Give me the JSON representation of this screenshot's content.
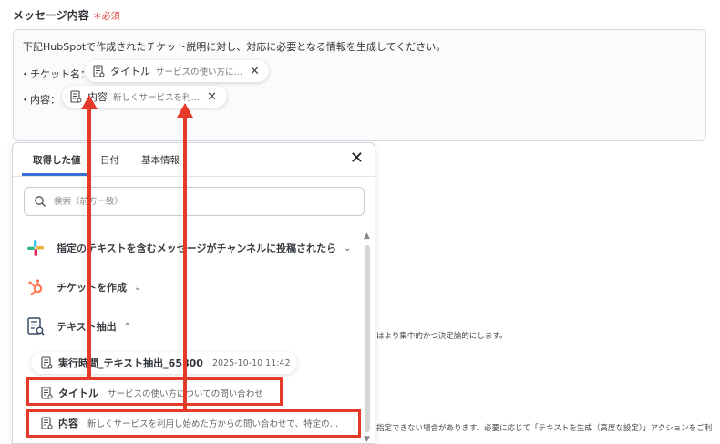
{
  "field": {
    "label": "メッセージ内容",
    "required_mark": "＊必須"
  },
  "message": {
    "line1": "下記HubSpotで作成されたチケット説明に対し、対応に必要となる情報を生成してください。",
    "row1_label": "・チケット名：",
    "row2_label": "・内容：",
    "chip1": {
      "name": "タイトル",
      "value": "サービスの使い方に…",
      "close": "✕"
    },
    "chip2": {
      "name": "内容",
      "value": "新しくサービスを利…",
      "close": "✕"
    }
  },
  "panel": {
    "tabs": [
      {
        "label": "取得した値",
        "active": true
      },
      {
        "label": "日付",
        "active": false
      },
      {
        "label": "基本情報",
        "active": false
      }
    ],
    "close": "✕",
    "search": {
      "placeholder": "検索（前方一致）"
    },
    "sections": [
      {
        "label": "指定のテキストを含むメッセージがチャンネルに投稿されたら",
        "chevron": "⌄",
        "icon": "slack-icon"
      },
      {
        "label": "チケットを作成",
        "chevron": "⌄",
        "icon": "hubspot-icon"
      },
      {
        "label": "テキスト抽出",
        "chevron": "⌃",
        "icon": "text-extract-icon"
      }
    ],
    "items": [
      {
        "name": "実行時間_テキスト抽出_65800",
        "value": "2025-10-10 11:42"
      },
      {
        "name": "タイトル",
        "value": "サービスの使い方についての問い合わせ"
      },
      {
        "name": "内容",
        "value": "新しくサービスを利用し始めた方からの問い合わせで、特定の…"
      }
    ],
    "scroll": {
      "up": "▲",
      "down": "▼"
    }
  },
  "background": {
    "text1": "はより集中的かつ決定論的にします。",
    "text2": "指定できない場合があります。必要に応じて「テキストを生成（高度な設定）」アクションをご利"
  },
  "colors": {
    "accent_red": "#e5392a",
    "tab_active": "#3b6fd8"
  }
}
